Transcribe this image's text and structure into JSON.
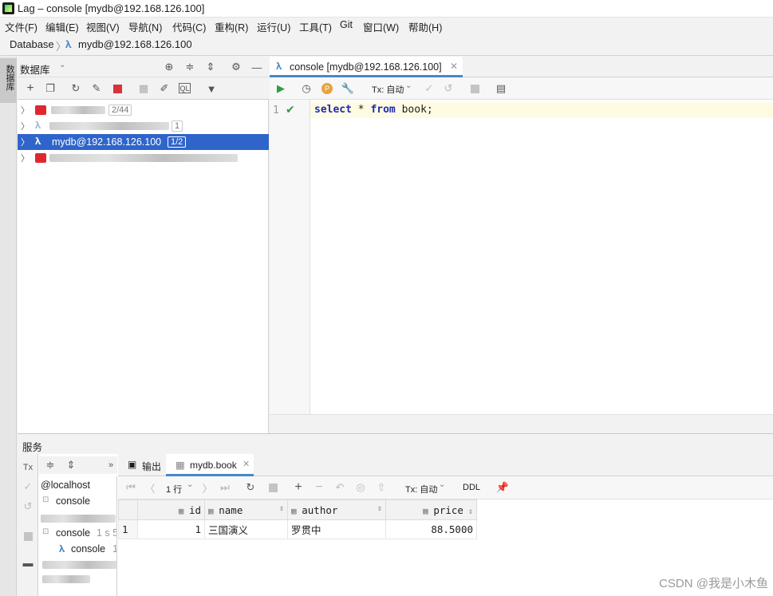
{
  "window": {
    "title": "Lag – console [mydb@192.168.126.100]"
  },
  "menu": [
    "文件(F)",
    "编辑(E)",
    "视图(V)",
    "导航(N)",
    "代码(C)",
    "重构(R)",
    "运行(U)",
    "工具(T)",
    "Git",
    "窗口(W)",
    "帮助(H)"
  ],
  "breadcrumb": {
    "root": "Database",
    "current": "mydb@192.168.126.100"
  },
  "left_strip": {
    "tab_label": "数据库"
  },
  "db_panel": {
    "title": "数据库",
    "tree": [
      {
        "label": "",
        "badge": "2/44",
        "selected": false
      },
      {
        "label": "",
        "badge": "1",
        "selected": false
      },
      {
        "label": "mydb@192.168.126.100",
        "badge": "1/2",
        "selected": true
      },
      {
        "label": "",
        "badge": "",
        "selected": false
      }
    ]
  },
  "editor": {
    "tab_label": "console [mydb@192.168.126.100]",
    "tx_mode": "Tx: 自动",
    "line_number": "1",
    "code": {
      "kw1": "select",
      "star": "*",
      "kw2": "from",
      "table": "book",
      "semi": ";"
    }
  },
  "services": {
    "title": "服务",
    "tree": {
      "host": "@localhost",
      "console1": "console",
      "console2": "console",
      "console2_time": "1 s 5",
      "console3": "console",
      "console3_time": "1"
    },
    "tabs": {
      "output": "输出",
      "result": "mydb.book"
    },
    "toolbar": {
      "rows": "1 行",
      "tx": "Tx: 自动",
      "ddl": "DDL"
    },
    "table": {
      "columns": [
        "id",
        "name",
        "author",
        "price"
      ],
      "rows": [
        {
          "num": "1",
          "id": "1",
          "name": "三国演义",
          "author": "罗贯中",
          "price": "88.5000"
        }
      ]
    }
  },
  "watermark": "CSDN @我是小木鱼",
  "colors": {
    "selection": "#2f65ca",
    "run": "#2e9c45",
    "stop": "#d8323b",
    "keyword": "#1a2cb0"
  }
}
